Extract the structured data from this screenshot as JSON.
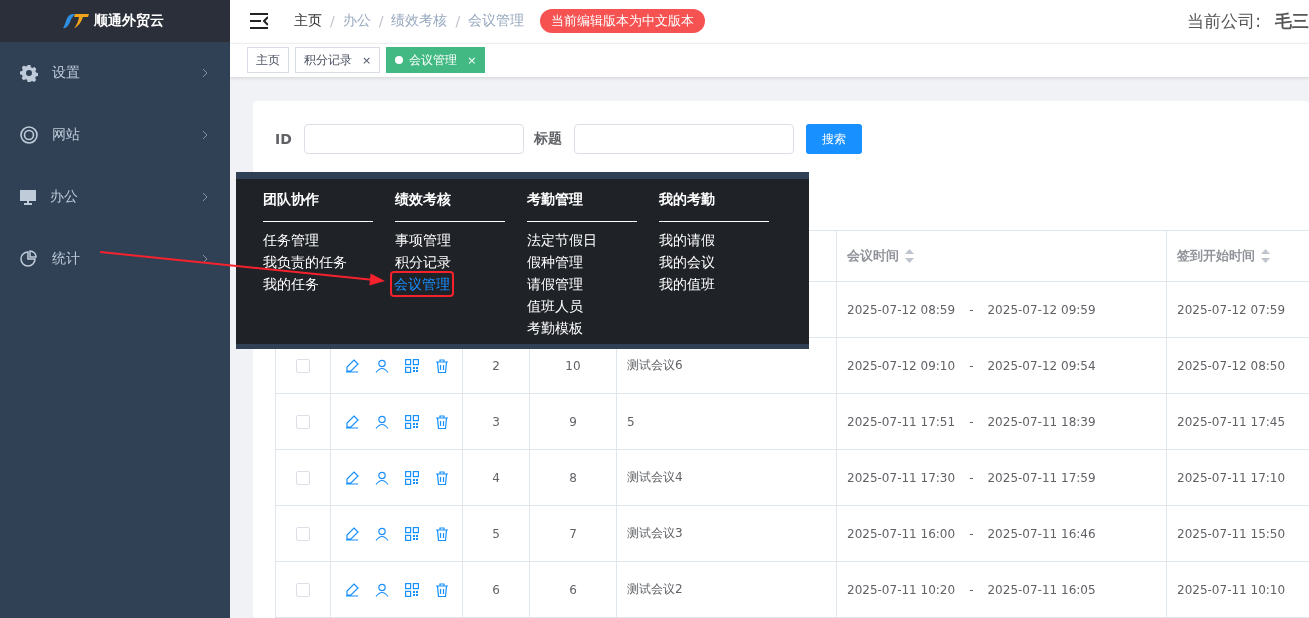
{
  "logo": {
    "text": "顺通外贸云"
  },
  "sidebar": {
    "items": [
      {
        "label": "设置",
        "selected": false
      },
      {
        "label": "网站",
        "selected": false
      },
      {
        "label": "办公",
        "selected": false
      },
      {
        "label": "统计",
        "selected": false
      }
    ]
  },
  "breadcrumb": {
    "separator": "/",
    "items": [
      "主页",
      "办公",
      "绩效考核",
      "会议管理"
    ]
  },
  "version_badge": "当前编辑版本为中文版本",
  "company": {
    "label": "当前公司:",
    "value": "毛三"
  },
  "tabs": [
    {
      "label": "主页",
      "selected": false,
      "closable": false
    },
    {
      "label": "积分记录",
      "selected": false,
      "closable": true
    },
    {
      "label": "会议管理",
      "selected": true,
      "closable": true
    }
  ],
  "tab_close": "×",
  "search": {
    "fields": [
      {
        "label": "ID"
      },
      {
        "label": "标题"
      }
    ],
    "button": "搜索"
  },
  "mega_menu": {
    "columns": [
      {
        "heading": "团队协作",
        "items": [
          {
            "label": "任务管理",
            "selected": false
          },
          {
            "label": "我负责的任务",
            "selected": false
          },
          {
            "label": "我的任务",
            "selected": false
          }
        ]
      },
      {
        "heading": "绩效考核",
        "items": [
          {
            "label": "事项管理",
            "selected": false
          },
          {
            "label": "积分记录",
            "selected": false
          },
          {
            "label": "会议管理",
            "selected": true
          }
        ]
      },
      {
        "heading": "考勤管理",
        "items": [
          {
            "label": "法定节假日",
            "selected": false
          },
          {
            "label": "假种管理",
            "selected": false
          },
          {
            "label": "请假管理",
            "selected": false
          },
          {
            "label": "值班人员",
            "selected": false
          },
          {
            "label": "考勤模板",
            "selected": false
          }
        ]
      },
      {
        "heading": "我的考勤",
        "items": [
          {
            "label": "我的请假",
            "selected": false
          },
          {
            "label": "我的会议",
            "selected": false
          },
          {
            "label": "我的值班",
            "selected": false
          }
        ]
      }
    ]
  },
  "table": {
    "columns": [
      {
        "label": "会议时间",
        "sortable": true
      },
      {
        "label": "签到开始时间",
        "sortable": true
      }
    ],
    "time_separator": "-",
    "rows": [
      {
        "id": "",
        "count": "",
        "title": "",
        "start": "2025-07-12 08:59",
        "end": "2025-07-12 09:59",
        "checkin": "2025-07-12 07:59"
      },
      {
        "checked": false,
        "id": "2",
        "count": "10",
        "title": "测试会议6",
        "start": "2025-07-12 09:10",
        "end": "2025-07-12 09:54",
        "checkin": "2025-07-12 08:50"
      },
      {
        "checked": false,
        "id": "3",
        "count": "9",
        "title": "5",
        "start": "2025-07-11 17:51",
        "end": "2025-07-11 18:39",
        "checkin": "2025-07-11 17:45"
      },
      {
        "checked": false,
        "id": "4",
        "count": "8",
        "title": "测试会议4",
        "start": "2025-07-11 17:30",
        "end": "2025-07-11 17:59",
        "checkin": "2025-07-11 17:10"
      },
      {
        "checked": false,
        "id": "5",
        "count": "7",
        "title": "测试会议3",
        "start": "2025-07-11 16:00",
        "end": "2025-07-11 16:46",
        "checkin": "2025-07-11 15:50"
      },
      {
        "checked": false,
        "id": "6",
        "count": "6",
        "title": "测试会议2",
        "start": "2025-07-11 10:20",
        "end": "2025-07-11 16:05",
        "checkin": "2025-07-11 10:10"
      }
    ]
  }
}
